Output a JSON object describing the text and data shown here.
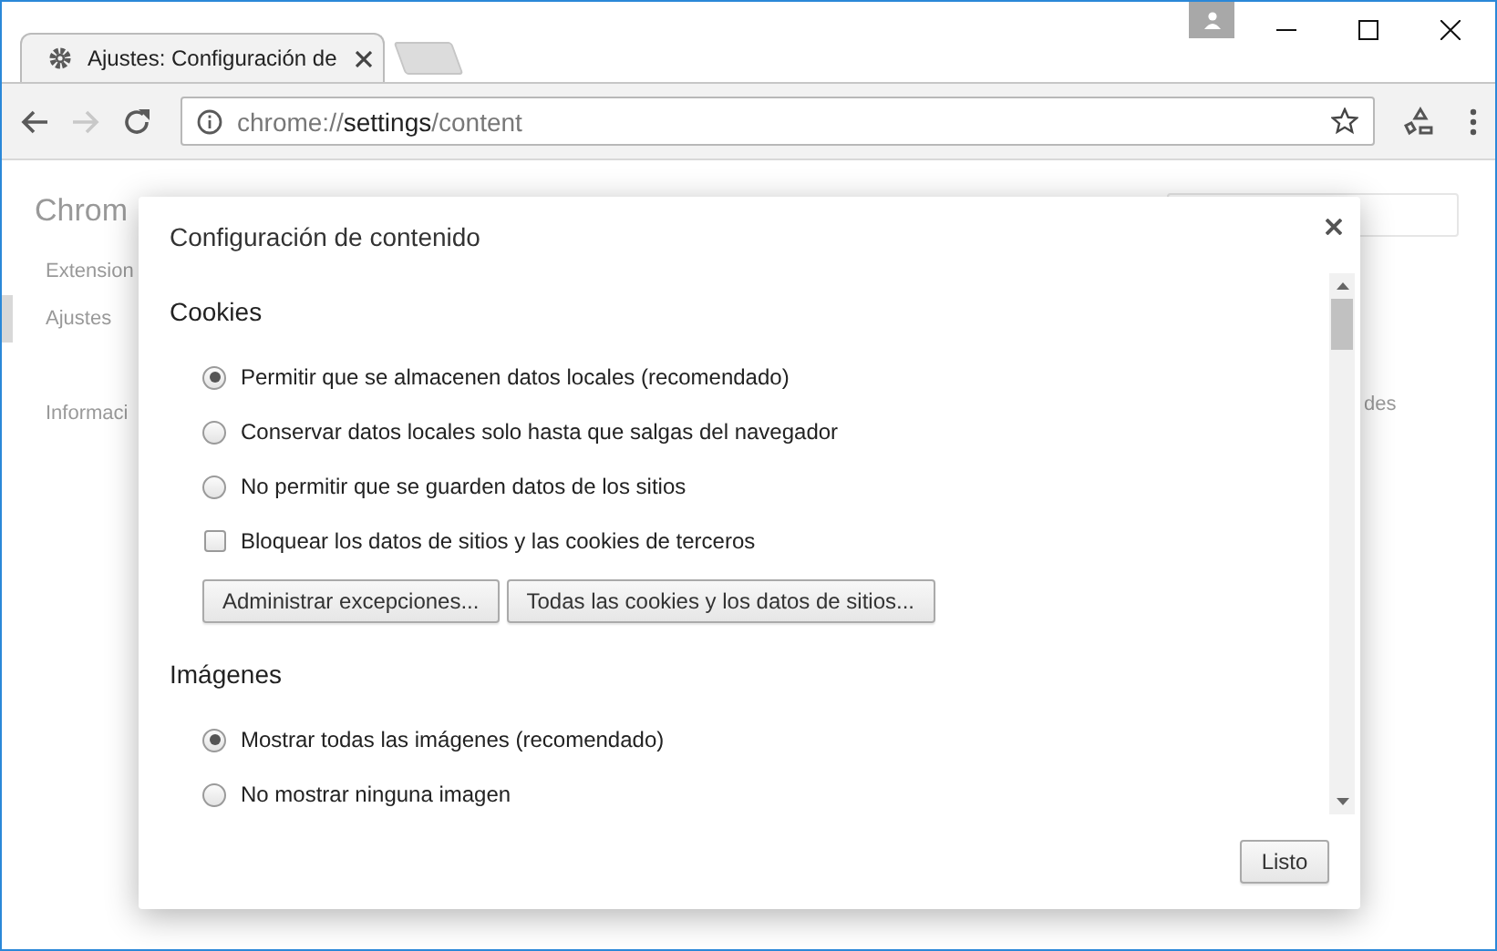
{
  "browser": {
    "tab_title": "Ajustes: Configuración de",
    "url": {
      "scheme": "chrome://",
      "host": "settings",
      "path": "/content"
    },
    "nav_buttons": [
      {
        "kind": "back",
        "disabled": false
      },
      {
        "kind": "forward",
        "disabled": true
      },
      {
        "kind": "reload",
        "disabled": false
      }
    ]
  },
  "background_page": {
    "title": "Chrom",
    "sidebar": [
      {
        "label": "Extension",
        "selected": false
      },
      {
        "label": "Ajustes",
        "selected": true
      },
      {
        "label": "Informaci",
        "selected": false
      }
    ],
    "side_text": "des"
  },
  "dialog": {
    "title": "Configuración de contenido",
    "sections": [
      {
        "heading": "Cookies",
        "items": [
          {
            "kind": "radio",
            "label": "Permitir que se almacenen datos locales (recomendado)",
            "selected": true
          },
          {
            "kind": "radio",
            "label": "Conservar datos locales solo hasta que salgas del navegador",
            "selected": false
          },
          {
            "kind": "radio",
            "label": "No permitir que se guarden datos de los sitios",
            "selected": false
          },
          {
            "kind": "checkbox",
            "label": "Bloquear los datos de sitios y las cookies de terceros",
            "checked": false
          },
          {
            "kind": "buttons",
            "buttons": [
              "Administrar excepciones...",
              "Todas las cookies y los datos de sitios..."
            ]
          }
        ]
      },
      {
        "heading": "Imágenes",
        "items": [
          {
            "kind": "radio",
            "label": "Mostrar todas las imágenes (recomendado)",
            "selected": true
          },
          {
            "kind": "radio",
            "label": "No mostrar ninguna imagen",
            "selected": false
          }
        ]
      }
    ],
    "done_button": "Listo"
  }
}
